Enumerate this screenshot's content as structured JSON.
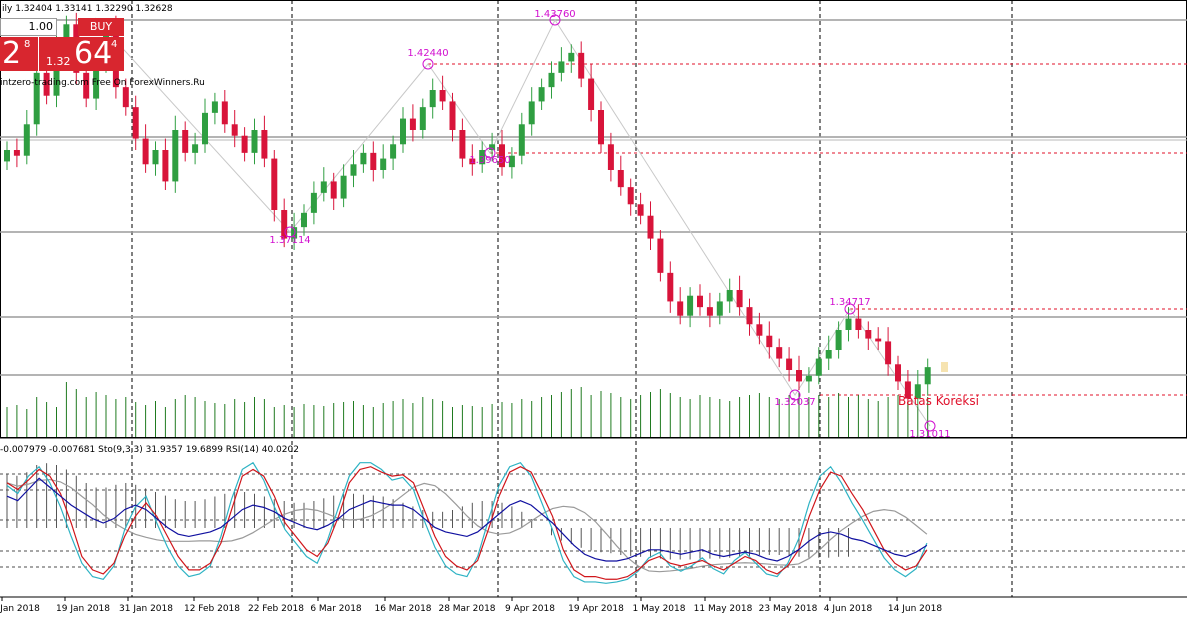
{
  "header": {
    "title_fragment": "ily",
    "ohlc": "1.32404 1.33141 1.32290 1.32628"
  },
  "trade_panel": {
    "lot_value": "1.00",
    "buy_label": "BUY",
    "sell_price_big": "2",
    "sell_price_sup": "8",
    "buy_price_prefix": "1.32",
    "buy_price_big": "64",
    "buy_price_sup": "4"
  },
  "watermark": "intzero-trading.com Free On ForexWinners.Ru",
  "indicator_header": "-0.007979 -0.007681  Sto(9,3,3) 31.9357 19.6899  RSI(14) 40.0202",
  "price_labels": [
    {
      "text": "1.43760"
    },
    {
      "text": "1.42440"
    },
    {
      "text": "1.39650"
    },
    {
      "text": "1.37114"
    },
    {
      "text": "1.34717"
    },
    {
      "text": "1.32037"
    },
    {
      "text": "1.31011"
    }
  ],
  "annotation": "Batas Koreksi",
  "x_axis_dates": [
    "Jan 2018",
    "19 Jan 2018",
    "31 Jan 2018",
    "12 Feb 2018",
    "22 Feb 2018",
    "6 Mar 2018",
    "16 Mar 2018",
    "28 Mar 2018",
    "9 Apr 2018",
    "19 Apr 2018",
    "1 May 2018",
    "11 May 2018",
    "23 May 2018",
    "4 Jun 2018",
    "14 Jun 2018"
  ],
  "colors": {
    "bull": "#2f9e41",
    "bear": "#d8143a",
    "label": "#d10fcf",
    "annotation": "#e0102a",
    "volume": "#1f7a1f",
    "grid": "#000000",
    "stoch_main": "#d0161b",
    "stoch_signal": "#2eb3c4",
    "rsi": "#1010a0",
    "sma": "#9a9a9a"
  },
  "chart_data": {
    "type": "candlestick",
    "series_values": [
      1.403,
      1.401,
      1.412,
      1.43,
      1.422,
      1.438,
      1.447,
      1.43,
      1.421,
      1.433,
      1.445,
      1.425,
      1.418,
      1.407,
      1.398,
      1.403,
      1.392,
      1.41,
      1.402,
      1.405,
      1.416,
      1.42,
      1.412,
      1.408,
      1.402,
      1.41,
      1.4,
      1.382,
      1.372,
      1.376,
      1.381,
      1.388,
      1.392,
      1.386,
      1.394,
      1.398,
      1.402,
      1.396,
      1.4,
      1.405,
      1.414,
      1.41,
      1.418,
      1.424,
      1.42,
      1.41,
      1.4,
      1.398,
      1.403,
      1.405,
      1.397,
      1.401,
      1.412,
      1.42,
      1.425,
      1.43,
      1.434,
      1.437,
      1.428,
      1.417,
      1.405,
      1.396,
      1.39,
      1.384,
      1.38,
      1.372,
      1.36,
      1.35,
      1.345,
      1.352,
      1.348,
      1.345,
      1.35,
      1.354,
      1.348,
      1.342,
      1.338,
      1.334,
      1.33,
      1.326,
      1.322,
      1.324,
      1.33,
      1.333,
      1.34,
      1.344,
      1.34,
      1.337,
      1.336,
      1.328,
      1.322,
      1.316,
      1.321,
      1.327
    ],
    "volume": [
      30,
      32,
      28,
      40,
      35,
      30,
      55,
      48,
      40,
      45,
      42,
      38,
      40,
      35,
      32,
      36,
      30,
      38,
      42,
      40,
      36,
      34,
      33,
      38,
      35,
      40,
      38,
      30,
      32,
      30,
      33,
      32,
      31,
      34,
      35,
      36,
      32,
      30,
      34,
      36,
      38,
      34,
      40,
      38,
      36,
      30,
      32,
      31,
      30,
      33,
      35,
      34,
      38,
      36,
      40,
      42,
      45,
      48,
      50,
      42,
      46,
      44,
      40,
      38,
      42,
      45,
      48,
      44,
      40,
      38,
      42,
      40,
      38,
      36,
      40,
      42,
      44,
      40,
      38,
      42,
      45,
      40,
      42,
      40,
      44,
      40,
      42,
      38,
      36,
      40,
      42,
      35,
      30,
      40
    ],
    "stochastic_main": [
      80,
      75,
      82,
      90,
      85,
      72,
      50,
      25,
      15,
      12,
      20,
      40,
      55,
      65,
      55,
      40,
      25,
      15,
      15,
      20,
      35,
      60,
      85,
      90,
      85,
      70,
      50,
      40,
      30,
      25,
      35,
      55,
      80,
      90,
      92,
      88,
      85,
      86,
      80,
      60,
      40,
      25,
      18,
      15,
      22,
      45,
      70,
      88,
      92,
      88,
      72,
      55,
      30,
      15,
      10,
      10,
      8,
      8,
      10,
      15,
      22,
      25,
      20,
      18,
      20,
      22,
      18,
      15,
      20,
      25,
      22,
      15,
      12,
      18,
      30,
      55,
      75,
      88,
      85,
      72,
      60,
      45,
      30,
      20,
      15,
      18,
      30
    ],
    "stochastic_signal": [
      78,
      72,
      85,
      92,
      80,
      62,
      40,
      20,
      10,
      8,
      18,
      45,
      62,
      70,
      50,
      32,
      18,
      10,
      12,
      18,
      40,
      68,
      90,
      95,
      82,
      62,
      45,
      35,
      25,
      20,
      38,
      62,
      85,
      95,
      95,
      90,
      82,
      84,
      75,
      52,
      32,
      18,
      12,
      10,
      25,
      52,
      78,
      92,
      95,
      85,
      65,
      45,
      22,
      10,
      6,
      6,
      5,
      6,
      8,
      14,
      24,
      28,
      18,
      14,
      18,
      24,
      16,
      12,
      22,
      28,
      20,
      12,
      10,
      20,
      38,
      65,
      85,
      92,
      80,
      65,
      52,
      38,
      24,
      15,
      10,
      16,
      35
    ],
    "rsi": [
      62,
      60,
      65,
      70,
      66,
      62,
      58,
      55,
      52,
      50,
      52,
      56,
      58,
      56,
      52,
      48,
      45,
      44,
      45,
      46,
      48,
      52,
      56,
      58,
      57,
      55,
      52,
      50,
      48,
      47,
      49,
      52,
      56,
      58,
      60,
      59,
      58,
      58,
      56,
      52,
      48,
      46,
      45,
      44,
      46,
      50,
      54,
      58,
      60,
      58,
      54,
      50,
      45,
      40,
      36,
      34,
      33,
      33,
      34,
      36,
      38,
      38,
      37,
      36,
      37,
      38,
      36,
      35,
      36,
      37,
      36,
      34,
      33,
      35,
      38,
      42,
      45,
      46,
      45,
      43,
      42,
      40,
      38,
      36,
      35,
      37,
      40
    ],
    "macd_histogram": [
      60,
      58,
      62,
      70,
      72,
      70,
      65,
      58,
      50,
      45,
      45,
      48,
      50,
      48,
      44,
      40,
      36,
      32,
      30,
      30,
      32,
      35,
      38,
      40,
      40,
      38,
      35,
      32,
      30,
      28,
      28,
      30,
      33,
      36,
      38,
      38,
      37,
      36,
      35,
      32,
      28,
      24,
      20,
      18,
      18,
      20,
      24,
      28,
      30,
      30,
      28,
      24,
      18,
      10,
      0,
      -8,
      -14,
      -18,
      -22,
      -25,
      -27,
      -28,
      -30,
      -31,
      -32,
      -33,
      -34,
      -35,
      -35,
      -35,
      -34,
      -34,
      -34,
      -33,
      -32,
      -31,
      -30,
      -30,
      -30,
      -31,
      -32,
      -33,
      -33,
      -33,
      -32,
      -32
    ]
  }
}
